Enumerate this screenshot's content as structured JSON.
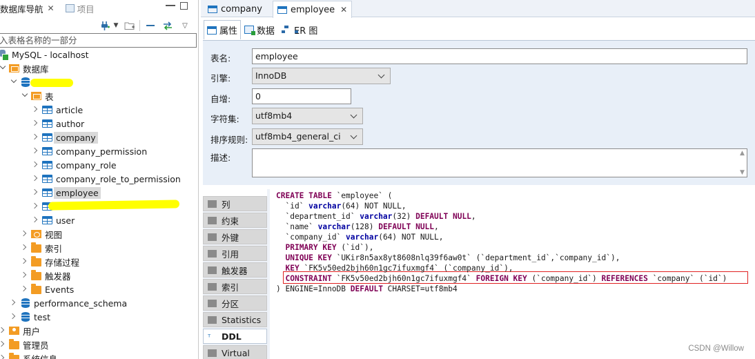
{
  "navigator": {
    "tab_label": "数据库导航",
    "tab_close": "✕",
    "project_tab_label": "项目",
    "search_placeholder": "入表格名称的一部分",
    "tree": [
      {
        "label": "MySQL - localhost",
        "icon": "connection-icon"
      },
      {
        "label": "数据库",
        "icon": "folder-icon"
      },
      {
        "label": "",
        "icon": "database-icon",
        "redacted": true
      },
      {
        "label": "表",
        "icon": "folder-grid-icon"
      },
      {
        "label": "article",
        "icon": "table-icon"
      },
      {
        "label": "author",
        "icon": "table-icon"
      },
      {
        "label": "company",
        "icon": "table-icon"
      },
      {
        "label": "company_permission",
        "icon": "table-icon"
      },
      {
        "label": "company_role",
        "icon": "table-icon"
      },
      {
        "label": "company_role_to_permission",
        "icon": "table-icon"
      },
      {
        "label": "employee",
        "icon": "table-icon"
      },
      {
        "label": "",
        "icon": "table-icon",
        "redacted": true
      },
      {
        "label": "user",
        "icon": "table-icon"
      },
      {
        "label": "视图",
        "icon": "view-folder-icon"
      },
      {
        "label": "索引",
        "icon": "folder-icon"
      },
      {
        "label": "存储过程",
        "icon": "folder-icon"
      },
      {
        "label": "触发器",
        "icon": "folder-icon"
      },
      {
        "label": "Events",
        "icon": "folder-icon"
      },
      {
        "label": "performance_schema",
        "icon": "database-icon"
      },
      {
        "label": "test",
        "icon": "database-icon"
      },
      {
        "label": "用户",
        "icon": "user-folder-icon"
      },
      {
        "label": "管理员",
        "icon": "admin-folder-icon"
      },
      {
        "label": "系统信息",
        "icon": "folder-icon"
      }
    ]
  },
  "editor": {
    "tabs": [
      {
        "label": "company"
      },
      {
        "label": "employee"
      }
    ],
    "tab_close": "✕",
    "subtabs": [
      "属性",
      "数据",
      "ER 图"
    ],
    "props": {
      "table_name_label": "表名:",
      "table_name_value": "employee",
      "engine_label": "引擎:",
      "engine_value": "InnoDB",
      "auto_inc_label": "自增:",
      "auto_inc_value": "0",
      "charset_label": "字符集:",
      "charset_value": "utf8mb4",
      "collation_label": "排序规则:",
      "collation_value": "utf8mb4_general_ci",
      "desc_label": "描述:",
      "desc_value": ""
    },
    "side_tabs": [
      "列",
      "约束",
      "外键",
      "引用",
      "触发器",
      "索引",
      "分区",
      "Statistics",
      "DDL",
      "Virtual"
    ],
    "active_side_tab": "DDL",
    "ddl_lines": [
      [
        {
          "t": "CREATE TABLE",
          "c": "kw"
        },
        {
          "t": " `employee` ("
        }
      ],
      [
        {
          "t": "  `id` "
        },
        {
          "t": "varchar",
          "c": "kt"
        },
        {
          "t": "(64) NOT NULL,"
        }
      ],
      [
        {
          "t": "  `department_id` "
        },
        {
          "t": "varchar",
          "c": "kt"
        },
        {
          "t": "(32) "
        },
        {
          "t": "DEFAULT NULL",
          "c": "kw"
        },
        {
          "t": ","
        }
      ],
      [
        {
          "t": "  `name` "
        },
        {
          "t": "varchar",
          "c": "kt"
        },
        {
          "t": "(128) "
        },
        {
          "t": "DEFAULT NULL",
          "c": "kw"
        },
        {
          "t": ","
        }
      ],
      [
        {
          "t": "  `company_id` "
        },
        {
          "t": "varchar",
          "c": "kt"
        },
        {
          "t": "(64) NOT NULL,"
        }
      ],
      [
        {
          "t": "  "
        },
        {
          "t": "PRIMARY KEY",
          "c": "kw"
        },
        {
          "t": " (`id`),"
        }
      ],
      [
        {
          "t": "  "
        },
        {
          "t": "UNIQUE KEY",
          "c": "kw"
        },
        {
          "t": " `UKir8n5ax8yt8608nlq39f6aw0t` (`department_id`,`company_id`),"
        }
      ],
      [
        {
          "t": "  "
        },
        {
          "t": "KEY",
          "c": "kw"
        },
        {
          "t": " `FK5v50ed2bjh60n1gc7ifuxmgf4` (`company_id`),"
        }
      ],
      [
        {
          "t": "  "
        },
        {
          "t": "CONSTRAINT",
          "c": "kw"
        },
        {
          "t": " `FK5v50ed2bjh60n1gc7ifuxmgf4` "
        },
        {
          "t": "FOREIGN KEY",
          "c": "kw"
        },
        {
          "t": " (`company_id`) "
        },
        {
          "t": "REFERENCES",
          "c": "kw"
        },
        {
          "t": " `company` (`id`)"
        }
      ],
      [
        {
          "t": ") ENGINE=InnoDB "
        },
        {
          "t": "DEFAULT",
          "c": "kw"
        },
        {
          "t": " CHARSET=utf8mb4"
        }
      ]
    ],
    "highlight_line": 8
  },
  "watermark": "CSDN @Willow",
  "colors": {
    "accent": "#1e73be",
    "folder": "#f39c24",
    "highlight_box": "#e02020",
    "redaction": "#ffff00"
  }
}
